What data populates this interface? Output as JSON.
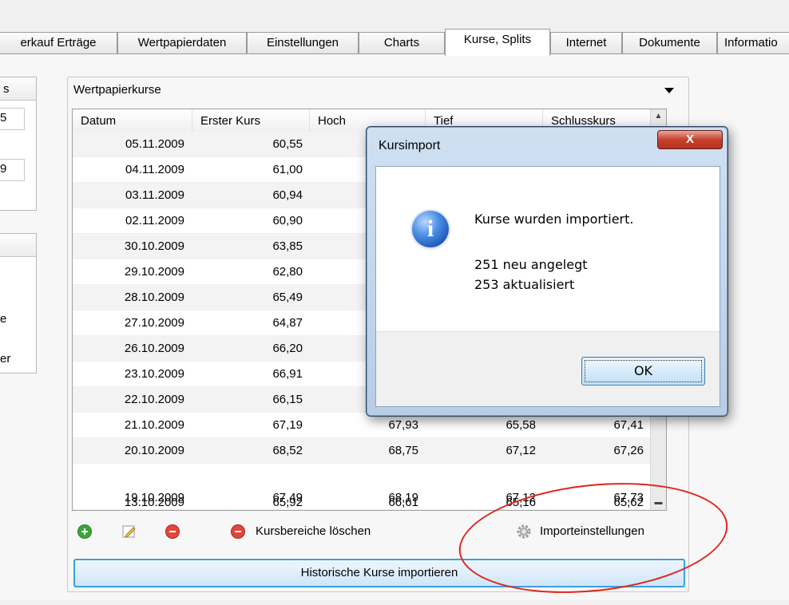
{
  "tabs": [
    {
      "label": "erkauf Erträge",
      "active": false
    },
    {
      "label": "Wertpapierdaten",
      "active": false
    },
    {
      "label": "Einstellungen",
      "active": false
    },
    {
      "label": "Charts",
      "active": false
    },
    {
      "label": "Kurse, Splits",
      "active": true
    },
    {
      "label": "Internet",
      "active": false
    },
    {
      "label": "Dokumente",
      "active": false
    },
    {
      "label": "Informatio",
      "active": false
    }
  ],
  "left_panel": {
    "top_header_fragment": "s",
    "fragment_1": "5",
    "fragment_2": "9",
    "fragment_3": "e",
    "fragment_4": "er"
  },
  "prices": {
    "group_title": "Wertpapierkurse",
    "columns": [
      "Datum",
      "Erster Kurs",
      "Hoch",
      "Tief",
      "Schlusskurs"
    ],
    "rows": [
      {
        "datum": "05.11.2009",
        "erster": "60,55",
        "hoch": "",
        "tief": "",
        "schluss": ""
      },
      {
        "datum": "04.11.2009",
        "erster": "61,00",
        "hoch": "",
        "tief": "",
        "schluss": ""
      },
      {
        "datum": "03.11.2009",
        "erster": "60,94",
        "hoch": "",
        "tief": "",
        "schluss": ""
      },
      {
        "datum": "02.11.2009",
        "erster": "60,90",
        "hoch": "",
        "tief": "",
        "schluss": ""
      },
      {
        "datum": "30.10.2009",
        "erster": "63,85",
        "hoch": "",
        "tief": "",
        "schluss": ""
      },
      {
        "datum": "29.10.2009",
        "erster": "62,80",
        "hoch": "",
        "tief": "",
        "schluss": ""
      },
      {
        "datum": "28.10.2009",
        "erster": "65,49",
        "hoch": "",
        "tief": "",
        "schluss": ""
      },
      {
        "datum": "27.10.2009",
        "erster": "64,87",
        "hoch": "",
        "tief": "",
        "schluss": ""
      },
      {
        "datum": "26.10.2009",
        "erster": "66,20",
        "hoch": "",
        "tief": "",
        "schluss": ""
      },
      {
        "datum": "23.10.2009",
        "erster": "66,91",
        "hoch": "",
        "tief": "",
        "schluss": ""
      },
      {
        "datum": "22.10.2009",
        "erster": "66,15",
        "hoch": "",
        "tief": "",
        "schluss": ""
      },
      {
        "datum": "21.10.2009",
        "erster": "67,19",
        "hoch": "67,93",
        "tief": "65,58",
        "schluss": "67,41"
      },
      {
        "datum": "20.10.2009",
        "erster": "68,52",
        "hoch": "68,75",
        "tief": "67,12",
        "schluss": "67,26"
      }
    ],
    "overdraw_row": {
      "a": {
        "datum": "19.10.2009",
        "erster": "67,49",
        "hoch": "68,19",
        "tief": "67,12",
        "schluss": "67,73"
      },
      "b": {
        "datum": "13.10.2009",
        "erster": "65,92",
        "hoch": "66,61",
        "tief": "65,16",
        "schluss": "65,62"
      }
    }
  },
  "toolbar": {
    "delete_ranges_label": "Kursbereiche löschen",
    "import_settings_label": "Importeinstellungen",
    "import_history_label": "Historische Kurse importieren"
  },
  "dialog": {
    "title": "Kursimport",
    "close_label": "X",
    "message_line1": "Kurse wurden importiert.",
    "message_line2": "251 neu angelegt",
    "message_line3": "253 aktualisiert",
    "ok_label": "OK"
  },
  "colors": {
    "annotation_ellipse": "#e0241b",
    "button_border_blue": "#3c9fe0",
    "add_green": "#3aa53a",
    "remove_red": "#e2463c"
  }
}
